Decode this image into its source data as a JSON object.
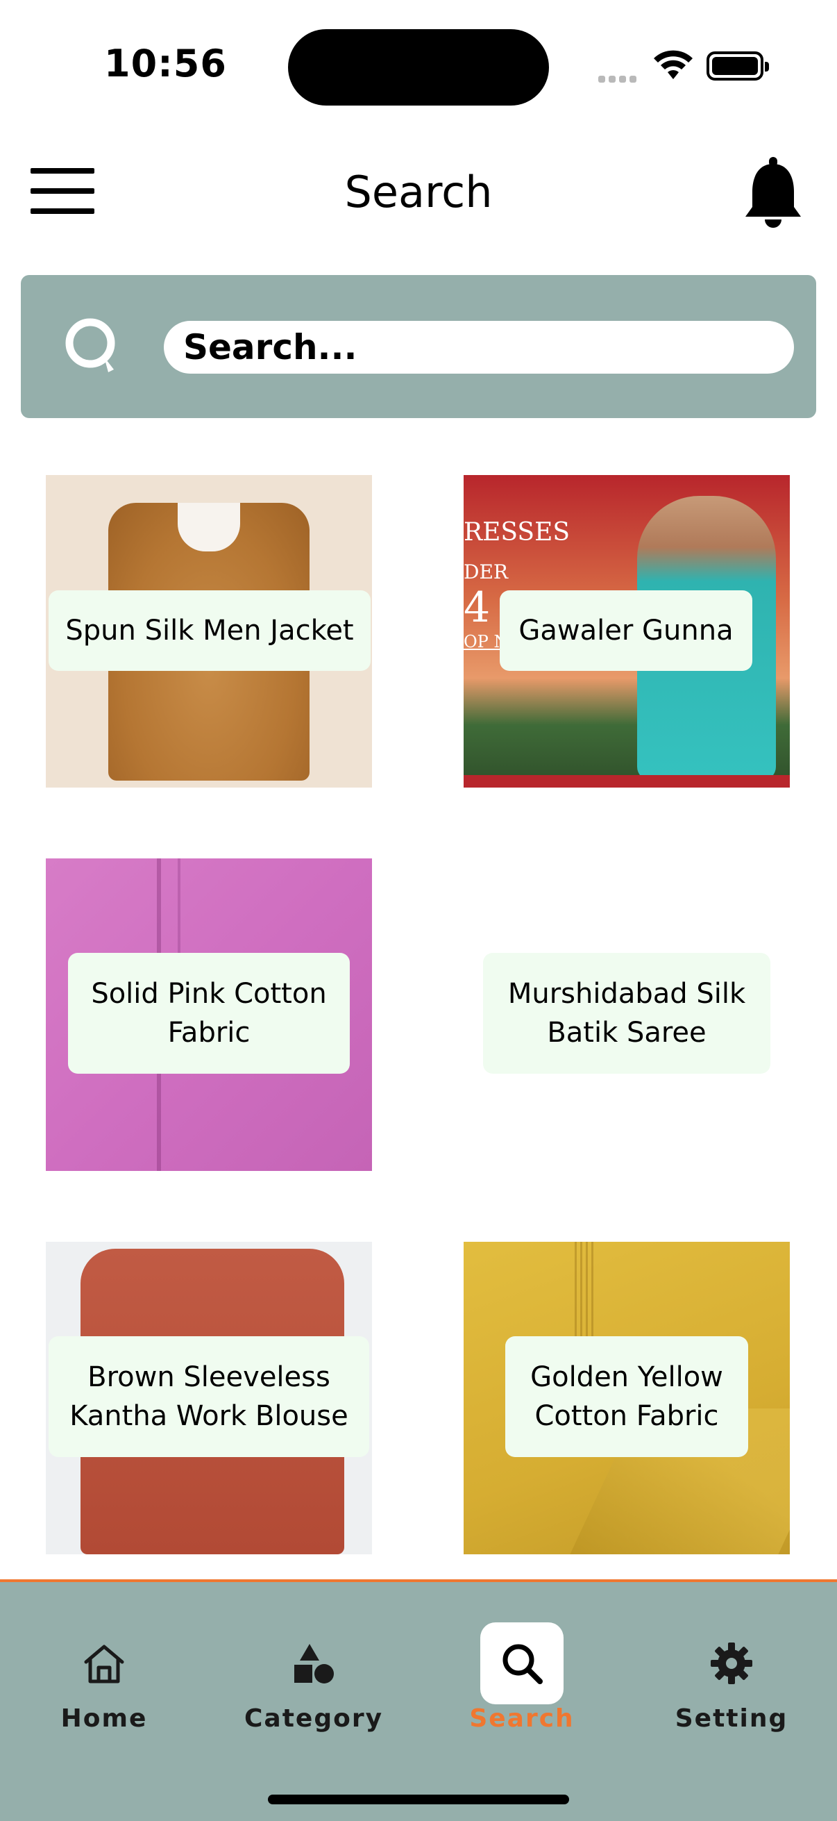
{
  "status_bar": {
    "time": "10:56"
  },
  "header": {
    "title": "Search"
  },
  "search": {
    "placeholder": "Search..."
  },
  "products": [
    {
      "name": "Spun Silk Men Jacket"
    },
    {
      "name": "Gawaler Gunna"
    },
    {
      "name": "Solid Pink Cotton Fabric"
    },
    {
      "name": "Murshidabad Silk Batik Saree"
    },
    {
      "name": "Brown Sleeveless Kantha Work Blouse"
    },
    {
      "name": "Golden Yellow Cotton Fabric"
    }
  ],
  "promo_fragment": {
    "line1": "RESSES",
    "line2": "DER",
    "line3": "4",
    "line4": "OP NOW"
  },
  "nav": {
    "items": [
      {
        "label": "Home",
        "icon": "home-icon"
      },
      {
        "label": "Category",
        "icon": "shapes-icon"
      },
      {
        "label": "Search",
        "icon": "search-icon",
        "active": true
      },
      {
        "label": "Setting",
        "icon": "gear-icon"
      }
    ]
  },
  "colors": {
    "accent": "#f07730",
    "bar": "#95afab",
    "label_bg": "#f0fcf0"
  }
}
